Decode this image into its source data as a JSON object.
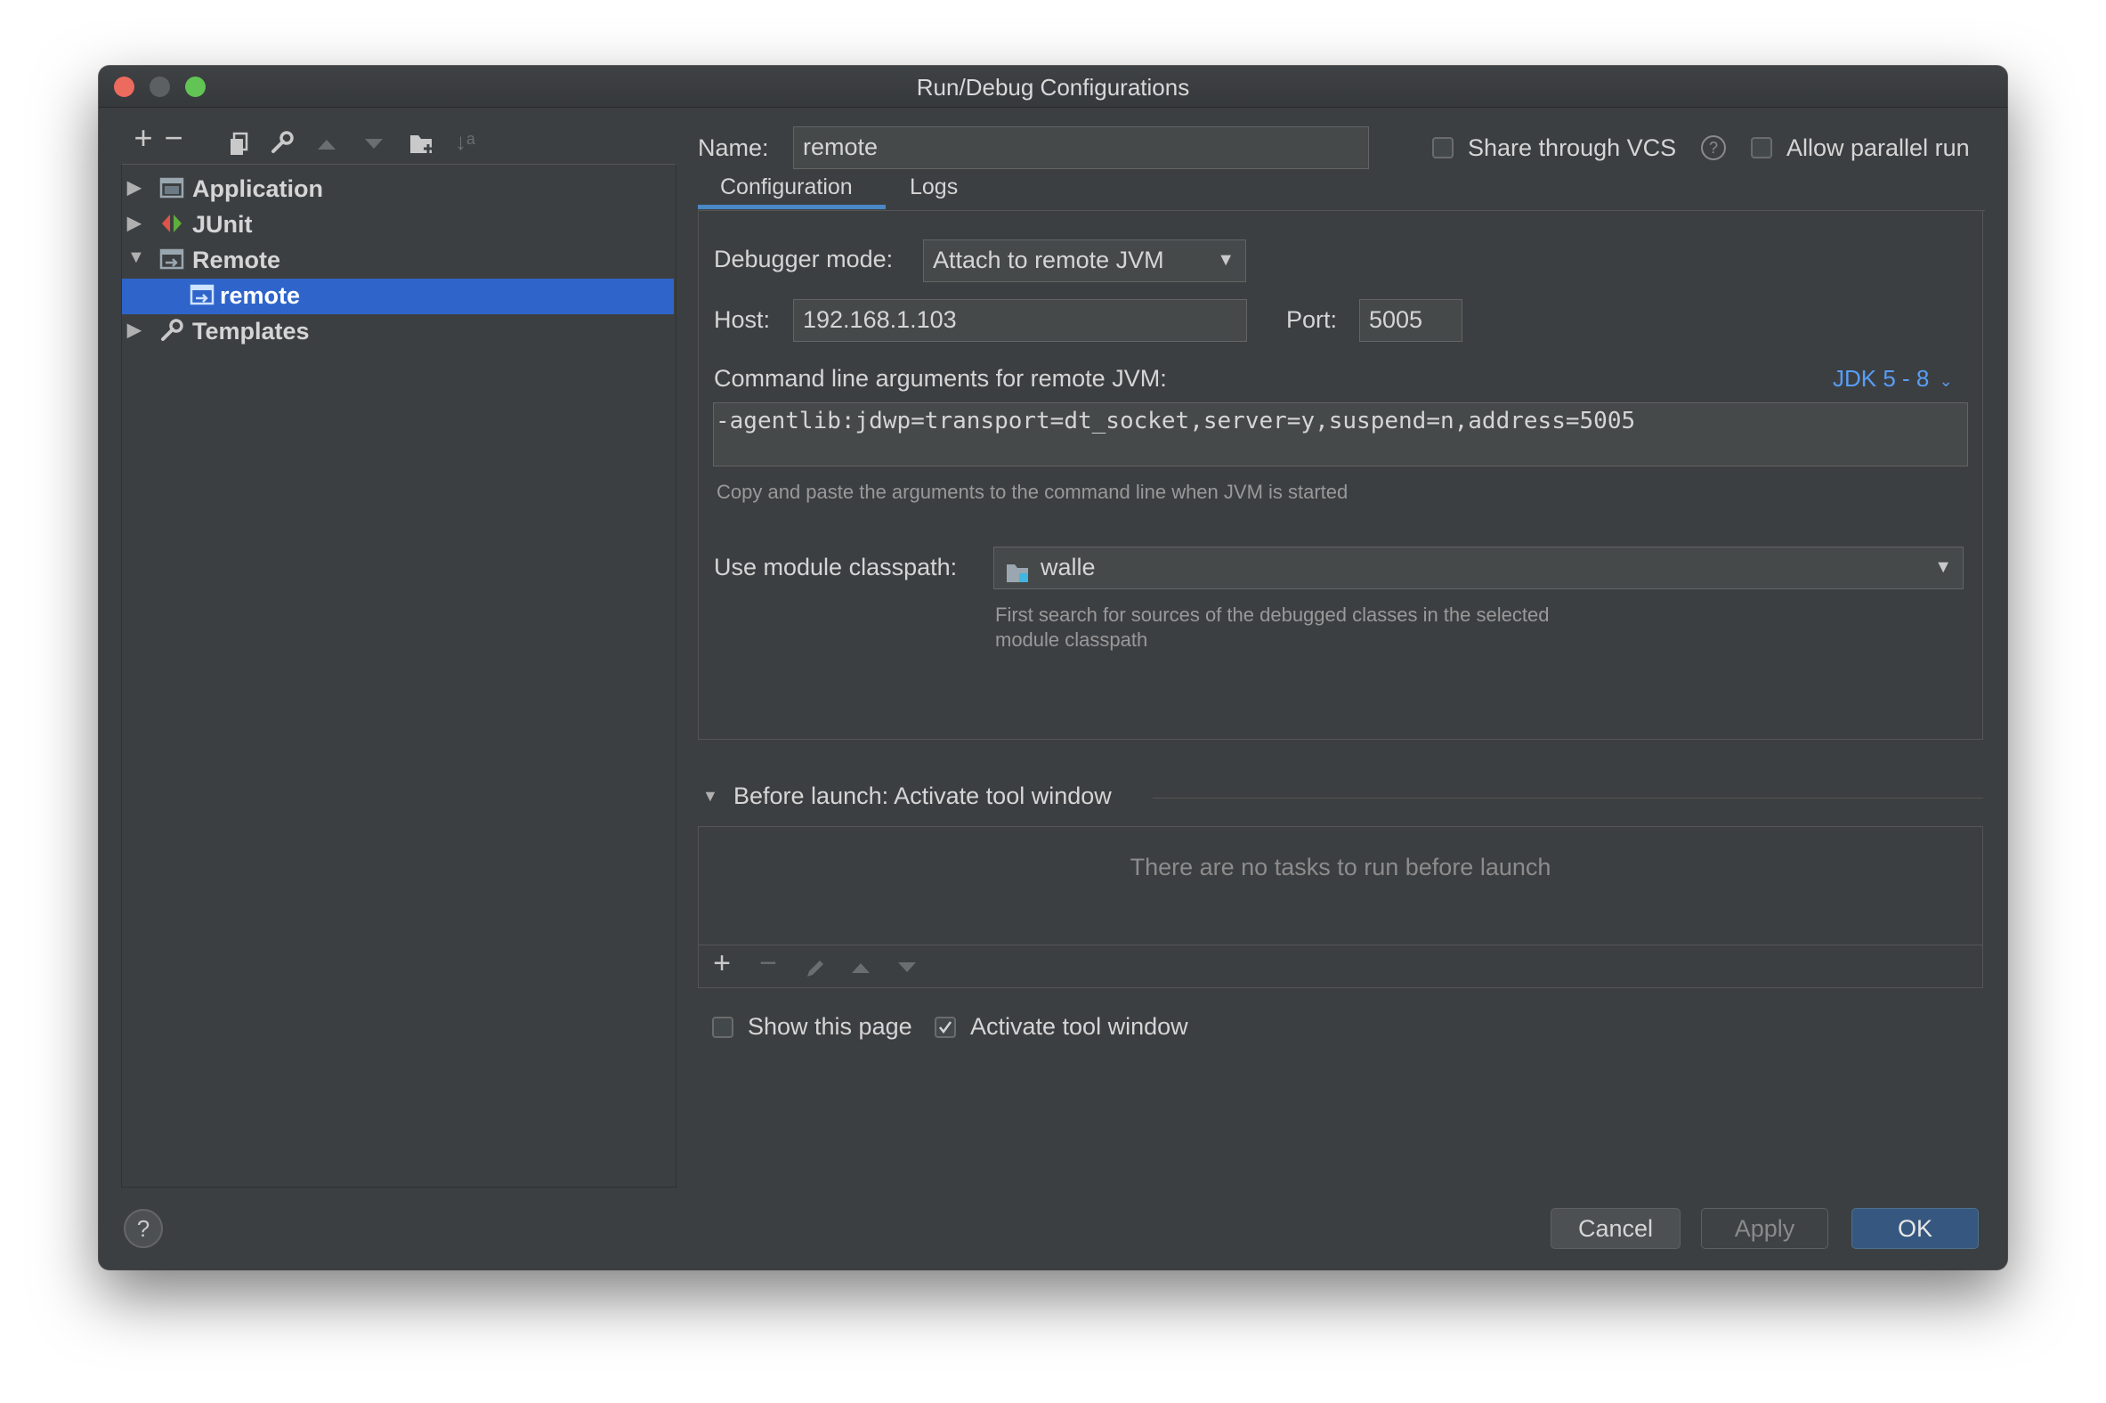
{
  "window": {
    "title": "Run/Debug Configurations"
  },
  "toolbar": {
    "add": "+",
    "remove": "−",
    "copy": "⧉",
    "edit": "🔧",
    "up": "▲",
    "down": "▼",
    "folder": "▣",
    "sort": "↓ᵃ"
  },
  "tree": {
    "items": [
      {
        "label": "Application",
        "expanded": false,
        "icon": "application-icon"
      },
      {
        "label": "JUnit",
        "expanded": false,
        "icon": "junit-icon"
      },
      {
        "label": "Remote",
        "expanded": true,
        "icon": "remote-icon"
      },
      {
        "label": "remote",
        "selected": true,
        "icon": "remote-config-icon"
      },
      {
        "label": "Templates",
        "expanded": false,
        "icon": "wrench-icon"
      }
    ]
  },
  "header": {
    "name_label": "Name:",
    "name_value": "remote",
    "share_label": "Share through VCS",
    "share_checked": false,
    "help_glyph": "?",
    "parallel_label": "Allow parallel run",
    "parallel_checked": false
  },
  "tabs": [
    {
      "label": "Configuration",
      "active": true
    },
    {
      "label": "Logs",
      "active": false
    }
  ],
  "config": {
    "debugger_mode_label": "Debugger mode:",
    "debugger_mode_value": "Attach to remote JVM",
    "host_label": "Host:",
    "host_value": "192.168.1.103",
    "port_label": "Port:",
    "port_value": "5005",
    "args_label": "Command line arguments for remote JVM:",
    "jdk_link": "JDK 5 - 8",
    "args_value": "-agentlib:jdwp=transport=dt_socket,server=y,suspend=n,address=5005",
    "args_hint": "Copy and paste the arguments to the command line when JVM is started",
    "classpath_label": "Use module classpath:",
    "classpath_value": "walle",
    "classpath_hint_1": "First search for sources of the debugged classes in the selected",
    "classpath_hint_2": "module classpath"
  },
  "before_launch": {
    "title": "Before launch: Activate tool window",
    "empty_text": "There are no tasks to run before launch",
    "show_page_label": "Show this page",
    "show_page_checked": false,
    "activate_label": "Activate tool window",
    "activate_checked": true
  },
  "footer": {
    "help": "?",
    "cancel": "Cancel",
    "apply": "Apply",
    "ok": "OK"
  },
  "colors": {
    "background": "#3c3f41",
    "selection": "#2f65ca",
    "accent_link": "#589df6",
    "primary_button": "#365880"
  }
}
